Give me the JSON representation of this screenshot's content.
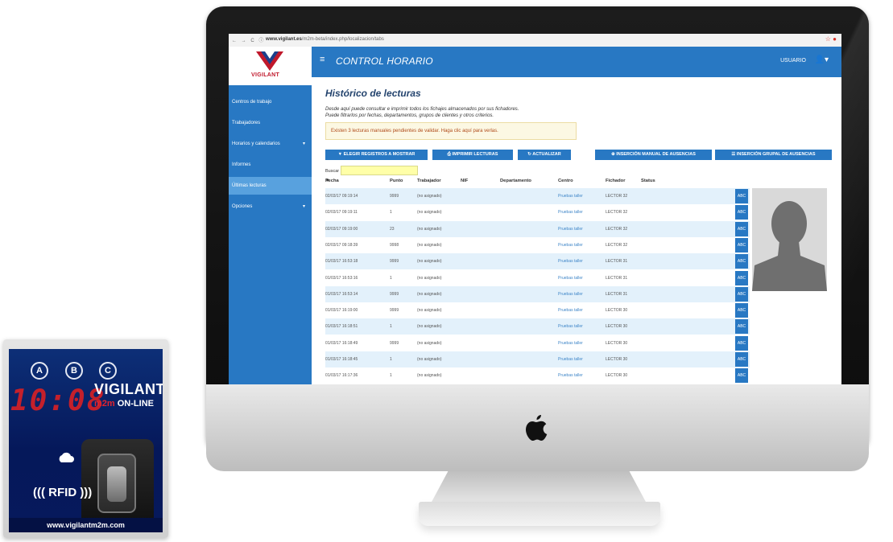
{
  "browser": {
    "url_domain": "www.vigilant.es",
    "url_path": "/m2m-beta/index.php/localizacion/tabs"
  },
  "sidebar": {
    "logo_text": "VIGILANT",
    "items": [
      {
        "label": "Centros de trabajo",
        "active": false,
        "has_caret": false
      },
      {
        "label": "Trabajadores",
        "active": false,
        "has_caret": false
      },
      {
        "label": "Horarios y calendarios",
        "active": false,
        "has_caret": true
      },
      {
        "label": "Informes",
        "active": false,
        "has_caret": false
      },
      {
        "label": "Últimas lecturas",
        "active": true,
        "has_caret": false
      },
      {
        "label": "Opciones",
        "active": false,
        "has_caret": true
      }
    ]
  },
  "topbar": {
    "title": "CONTROL HORARIO",
    "user_label": "USUARIO"
  },
  "main": {
    "page_title": "Histórico de lecturas",
    "description_line1": "Desde aquí puede consultar e imprimir todos los fichajes almacenados por sus fichadores.",
    "description_line2": "Puede filtrarlos por fechas, departamentos, grupos de clientes y otros criterios.",
    "alert": "Existen 3 lecturas manuales pendientes de validar. Haga clic aquí para verlas.",
    "buttons": {
      "elegir": "ELEGIR REGISTROS A MOSTRAR",
      "imprimir": "IMPRIMIR LECTURAS",
      "actualizar": "ACTUALIZAR",
      "insercion_manual": "INSERCIÓN MANUAL DE AUSENCIAS",
      "insercion_grupal": "INSERCIÓN GRUPAL DE AUSENCIAS"
    },
    "search_label": "Buscar",
    "search_value": "",
    "columns": [
      "Fecha",
      "Punto",
      "Trabajador",
      "NIF",
      "Departamento",
      "Centro",
      "Fichador",
      "Status"
    ],
    "abc_label": "ABC",
    "rows": [
      {
        "fecha": "02/03/17 09:19:14",
        "punto": "9999",
        "trabajador": "(no asignado)",
        "centro": "Pruebas taller",
        "fichador": "LECTOR 32"
      },
      {
        "fecha": "02/03/17 09:19:11",
        "punto": "1",
        "trabajador": "(no asignado)",
        "centro": "Pruebas taller",
        "fichador": "LECTOR 32"
      },
      {
        "fecha": "02/03/17 09:19:00",
        "punto": "23",
        "trabajador": "(no asignado)",
        "centro": "Pruebas taller",
        "fichador": "LECTOR 32"
      },
      {
        "fecha": "02/03/17 09:18:39",
        "punto": "9998",
        "trabajador": "(no asignado)",
        "centro": "Pruebas taller",
        "fichador": "LECTOR 32"
      },
      {
        "fecha": "01/03/17 16:53:18",
        "punto": "9999",
        "trabajador": "(no asignado)",
        "centro": "Pruebas taller",
        "fichador": "LECTOR 31"
      },
      {
        "fecha": "01/03/17 16:53:16",
        "punto": "1",
        "trabajador": "(no asignado)",
        "centro": "Pruebas taller",
        "fichador": "LECTOR 31"
      },
      {
        "fecha": "01/03/17 16:53:14",
        "punto": "9999",
        "trabajador": "(no asignado)",
        "centro": "Pruebas taller",
        "fichador": "LECTOR 31"
      },
      {
        "fecha": "01/03/17 16:19:00",
        "punto": "9999",
        "trabajador": "(no asignado)",
        "centro": "Pruebas taller",
        "fichador": "LECTOR 30"
      },
      {
        "fecha": "01/03/17 16:18:51",
        "punto": "1",
        "trabajador": "(no asignado)",
        "centro": "Pruebas taller",
        "fichador": "LECTOR 30"
      },
      {
        "fecha": "01/03/17 16:18:49",
        "punto": "9999",
        "trabajador": "(no asignado)",
        "centro": "Pruebas taller",
        "fichador": "LECTOR 30"
      },
      {
        "fecha": "01/03/17 16:18:45",
        "punto": "1",
        "trabajador": "(no asignado)",
        "centro": "Pruebas taller",
        "fichador": "LECTOR 30"
      },
      {
        "fecha": "01/03/17 16:17:36",
        "punto": "1",
        "trabajador": "(no asignado)",
        "centro": "Pruebas taller",
        "fichador": "LECTOR 30"
      }
    ]
  },
  "device": {
    "buttons": [
      "A",
      "B",
      "C"
    ],
    "time_display": "10:08",
    "brand": "VIGILANT",
    "brand_sub_red": "m2m",
    "brand_sub_white": "ON-LINE",
    "rfid_label": "((( RFID )))",
    "website": "www.vigilantm2m.com"
  },
  "colors": {
    "primary_blue": "#2878c3",
    "sidebar_active": "#58a1de",
    "alert_bg": "#fcf8e3",
    "alert_text": "#b04b1a",
    "row_alt": "#e3f1fb",
    "device_blue": "#0d2f77",
    "led_red": "#c4202b"
  }
}
